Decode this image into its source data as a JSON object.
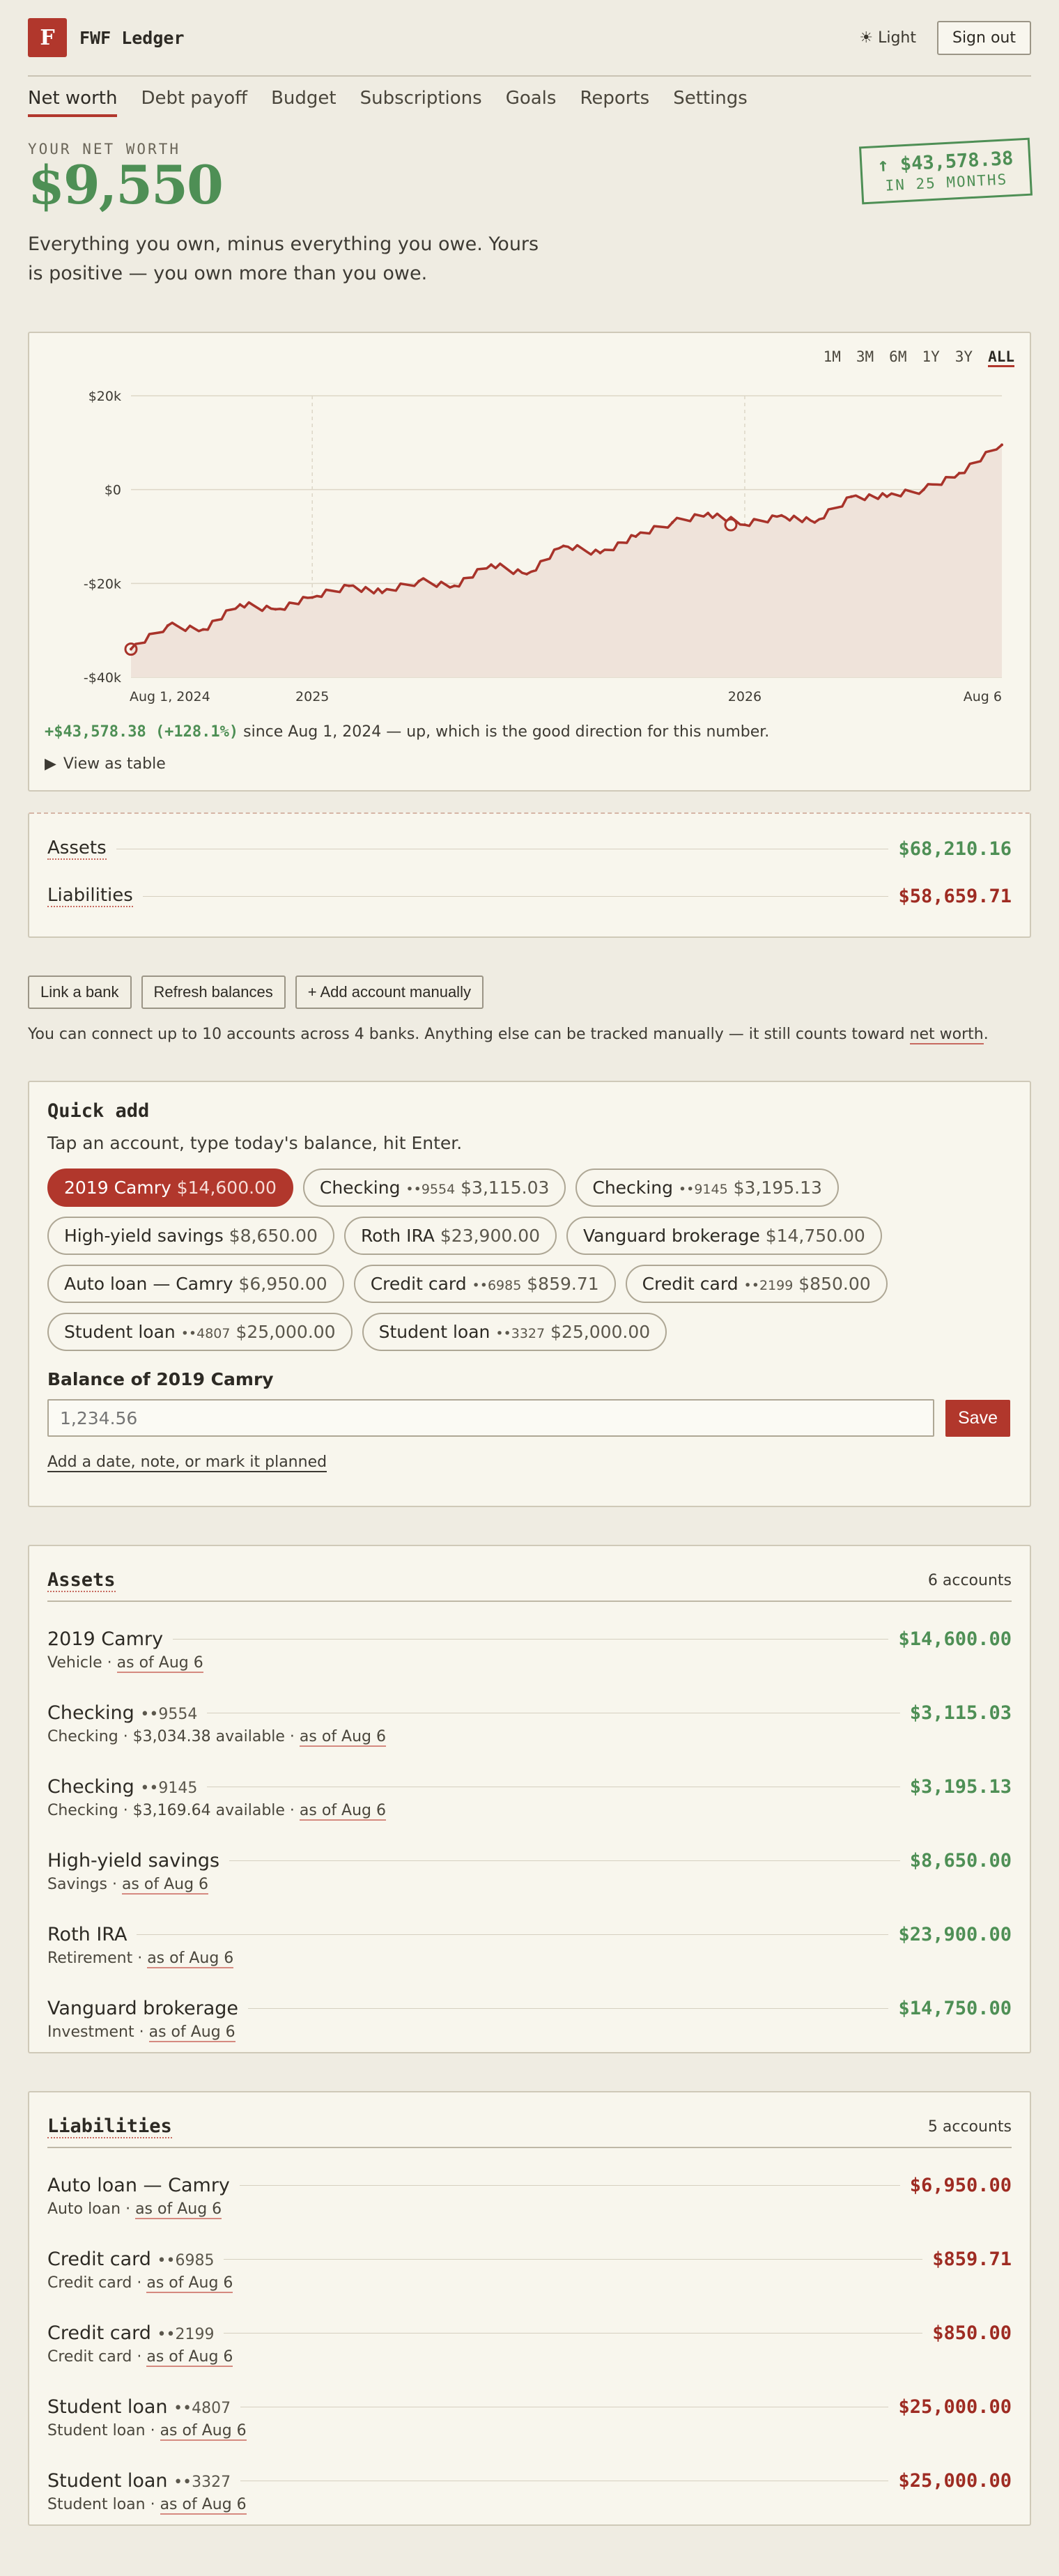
{
  "app": {
    "logo_letter": "F",
    "name": "FWF Ledger"
  },
  "header": {
    "theme_icon": "sun-icon",
    "theme_label": "☀ Light",
    "signout_label": "Sign out"
  },
  "nav": {
    "items": [
      "Net worth",
      "Debt payoff",
      "Budget",
      "Subscriptions",
      "Goals",
      "Reports",
      "Settings"
    ],
    "active": "Net worth"
  },
  "hero": {
    "label": "YOUR NET WORTH",
    "value": "$9,550",
    "description": "Everything you own, minus everything you owe. Yours is positive — you own more than you owe.",
    "stamp_value": "↑ $43,578.38",
    "stamp_sub": "IN 25 MONTHS"
  },
  "chart": {
    "ranges": [
      "1M",
      "3M",
      "6M",
      "1Y",
      "3Y",
      "ALL"
    ],
    "active_range": "ALL",
    "change_text": "+$43,578.38 (+128.1%)",
    "since_text": " since Aug 1, 2024 — up, which is the good direction for this number.",
    "table_toggle": "View as table"
  },
  "chart_data": {
    "type": "area",
    "x_ticks": [
      "Aug 1, 2024",
      "2025",
      "2026",
      "Aug 6"
    ],
    "y_ticks": [
      "$20k",
      "$0",
      "-$20k",
      "-$40k"
    ],
    "ylim": [
      -40000,
      20000
    ],
    "grid": true,
    "series": [
      {
        "x": [
          "2024-08-01",
          "2024-09-01",
          "2024-10-01",
          "2024-11-01",
          "2024-12-01",
          "2025-01-01",
          "2025-02-01",
          "2025-03-01",
          "2025-04-01",
          "2025-05-01",
          "2025-06-01",
          "2025-07-01",
          "2025-08-01",
          "2025-09-01",
          "2025-10-01",
          "2025-11-01",
          "2025-12-01",
          "2026-01-01",
          "2026-02-01",
          "2026-03-01",
          "2026-04-01",
          "2026-05-01",
          "2026-06-01",
          "2026-07-01",
          "2026-08-06"
        ],
        "values": [
          -34000,
          -29000,
          -29800,
          -24500,
          -25500,
          -23000,
          -20500,
          -22000,
          -19500,
          -20500,
          -16000,
          -18000,
          -12000,
          -13500,
          -10000,
          -7000,
          -5000,
          -7500,
          -5500,
          -7000,
          -1500,
          -1500,
          0,
          3500,
          9550
        ]
      }
    ]
  },
  "summary": {
    "assets_label": "Assets",
    "assets_value": "$68,210.16",
    "liabilities_label": "Liabilities",
    "liabilities_value": "$58,659.71"
  },
  "link": {
    "buttons": [
      "Link a bank",
      "Refresh balances",
      "+ Add account manually"
    ],
    "note_prefix": "You can connect up to 10 accounts across 4 banks. Anything else can be tracked manually — it still counts toward ",
    "note_link": "net worth",
    "note_suffix": "."
  },
  "quick_add": {
    "title": "Quick add",
    "subtitle": "Tap an account, type today's balance, hit Enter.",
    "chips": [
      {
        "name": "2019 Camry",
        "mask": "",
        "amount": "$14,600.00"
      },
      {
        "name": "Checking",
        "mask": "••9554",
        "amount": "$3,115.03"
      },
      {
        "name": "Checking",
        "mask": "••9145",
        "amount": "$3,195.13"
      },
      {
        "name": "High-yield savings",
        "mask": "",
        "amount": "$8,650.00"
      },
      {
        "name": "Roth IRA",
        "mask": "",
        "amount": "$23,900.00"
      },
      {
        "name": "Vanguard brokerage",
        "mask": "",
        "amount": "$14,750.00"
      },
      {
        "name": "Auto loan — Camry",
        "mask": "",
        "amount": "$6,950.00"
      },
      {
        "name": "Credit card",
        "mask": "••6985",
        "amount": "$859.71"
      },
      {
        "name": "Credit card",
        "mask": "••2199",
        "amount": "$850.00"
      },
      {
        "name": "Student loan",
        "mask": "••4807",
        "amount": "$25,000.00"
      },
      {
        "name": "Student loan",
        "mask": "••3327",
        "amount": "$25,000.00"
      }
    ],
    "field_label": "Balance of 2019 Camry",
    "placeholder": "1,234.56",
    "save_label": "Save",
    "more_link": "Add a date, note, or mark it planned"
  },
  "assets": {
    "title": "Assets",
    "count": "6 accounts",
    "items": [
      {
        "name": "2019 Camry",
        "mask": "",
        "value": "$14,600.00",
        "meta": "Vehicle · ",
        "asof": "as of Aug 6"
      },
      {
        "name": "Checking",
        "mask": "••9554",
        "value": "$3,115.03",
        "meta": "Checking · $3,034.38 available · ",
        "asof": "as of Aug 6"
      },
      {
        "name": "Checking",
        "mask": "••9145",
        "value": "$3,195.13",
        "meta": "Checking · $3,169.64 available · ",
        "asof": "as of Aug 6"
      },
      {
        "name": "High-yield savings",
        "mask": "",
        "value": "$8,650.00",
        "meta": "Savings · ",
        "asof": "as of Aug 6"
      },
      {
        "name": "Roth IRA",
        "mask": "",
        "value": "$23,900.00",
        "meta": "Retirement · ",
        "asof": "as of Aug 6"
      },
      {
        "name": "Vanguard brokerage",
        "mask": "",
        "value": "$14,750.00",
        "meta": "Investment · ",
        "asof": "as of Aug 6"
      }
    ]
  },
  "liabilities": {
    "title": "Liabilities",
    "count": "5 accounts",
    "items": [
      {
        "name": "Auto loan — Camry",
        "mask": "",
        "value": "$6,950.00",
        "meta": "Auto loan · ",
        "asof": "as of Aug 6"
      },
      {
        "name": "Credit card",
        "mask": "••6985",
        "value": "$859.71",
        "meta": "Credit card · ",
        "asof": "as of Aug 6"
      },
      {
        "name": "Credit card",
        "mask": "••2199",
        "value": "$850.00",
        "meta": "Credit card · ",
        "asof": "as of Aug 6"
      },
      {
        "name": "Student loan",
        "mask": "••4807",
        "value": "$25,000.00",
        "meta": "Student loan · ",
        "asof": "as of Aug 6"
      },
      {
        "name": "Student loan",
        "mask": "••3327",
        "value": "$25,000.00",
        "meta": "Student loan · ",
        "asof": "as of Aug 6"
      }
    ]
  },
  "colors": {
    "accent": "#b1372c",
    "positive": "#4e8f55",
    "negative": "#9e2b22",
    "background": "#efece2"
  }
}
